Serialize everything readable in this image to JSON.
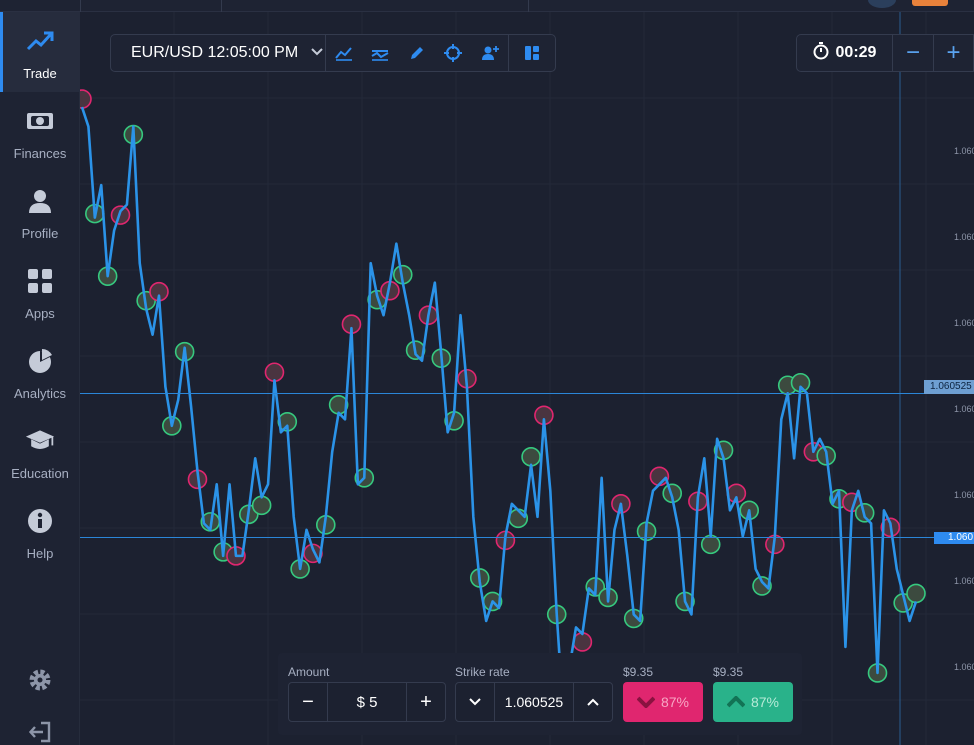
{
  "sidebar": {
    "items": [
      {
        "label": "Trade",
        "icon": "trending-up-icon",
        "active": true
      },
      {
        "label": "Finances",
        "icon": "banknote-icon"
      },
      {
        "label": "Profile",
        "icon": "user-icon"
      },
      {
        "label": "Apps",
        "icon": "apps-grid-icon"
      },
      {
        "label": "Analytics",
        "icon": "pie-chart-icon"
      },
      {
        "label": "Education",
        "icon": "graduation-cap-icon"
      },
      {
        "label": "Help",
        "icon": "info-icon"
      }
    ],
    "bottom": [
      "gear-icon",
      "logout-icon"
    ]
  },
  "toolbar": {
    "pair_label": "EUR/USD 12:05:00 PM",
    "tools": [
      "line-chart-icon",
      "indicators-icon",
      "pencil-icon",
      "crosshair-icon",
      "add-user-icon",
      "layout-icon"
    ]
  },
  "timer": {
    "value": "00:29",
    "minus": "−",
    "plus": "+"
  },
  "price_axis": {
    "current_price": "1.060525",
    "labels": [
      "1.060",
      "1.060",
      "1.060",
      "1.060",
      "1.060",
      "1.060",
      "1.060",
      "1.060",
      "1.060"
    ]
  },
  "chart_data": {
    "type": "line",
    "price_points": [
      10,
      13,
      27,
      22,
      36,
      29,
      26,
      25,
      13,
      34,
      41,
      45,
      39,
      53,
      59,
      55,
      47,
      56,
      66,
      74,
      75,
      68,
      79,
      68,
      79,
      79,
      72,
      64,
      70,
      68,
      52,
      60,
      59,
      73,
      81,
      75,
      78,
      80,
      73,
      63,
      57,
      58,
      44,
      68,
      67,
      34,
      39,
      42,
      37,
      31,
      37,
      42,
      48,
      49,
      42,
      37,
      48,
      60,
      57,
      42,
      53,
      73,
      83,
      89,
      86,
      87,
      76,
      71,
      72,
      73,
      65,
      73,
      58,
      69,
      88,
      103,
      96,
      90,
      91,
      84,
      85,
      67,
      86,
      75,
      71,
      79,
      88,
      89,
      74,
      69,
      68,
      67,
      70,
      75,
      86,
      88,
      70,
      64,
      76,
      61,
      64,
      72,
      70,
      76,
      72,
      81,
      83,
      84,
      76,
      58,
      54,
      64,
      53,
      54,
      63,
      61,
      63,
      71,
      69,
      93,
      72,
      69,
      73,
      74,
      97,
      72,
      74,
      81,
      85,
      89,
      86
    ]
  },
  "trade_panel": {
    "amount_label": "Amount",
    "amount_value": "$ 5",
    "amount_minus": "−",
    "amount_plus": "+",
    "strike_label": "Strike rate",
    "strike_value": "1.060525",
    "down_payout": "$9.35",
    "down_percent": "87%",
    "up_payout": "$9.35",
    "up_percent": "87%"
  },
  "colors": {
    "accent": "#2e8bf0",
    "down": "#e0266f",
    "up": "#29b28a",
    "line": "#2b93e8"
  }
}
